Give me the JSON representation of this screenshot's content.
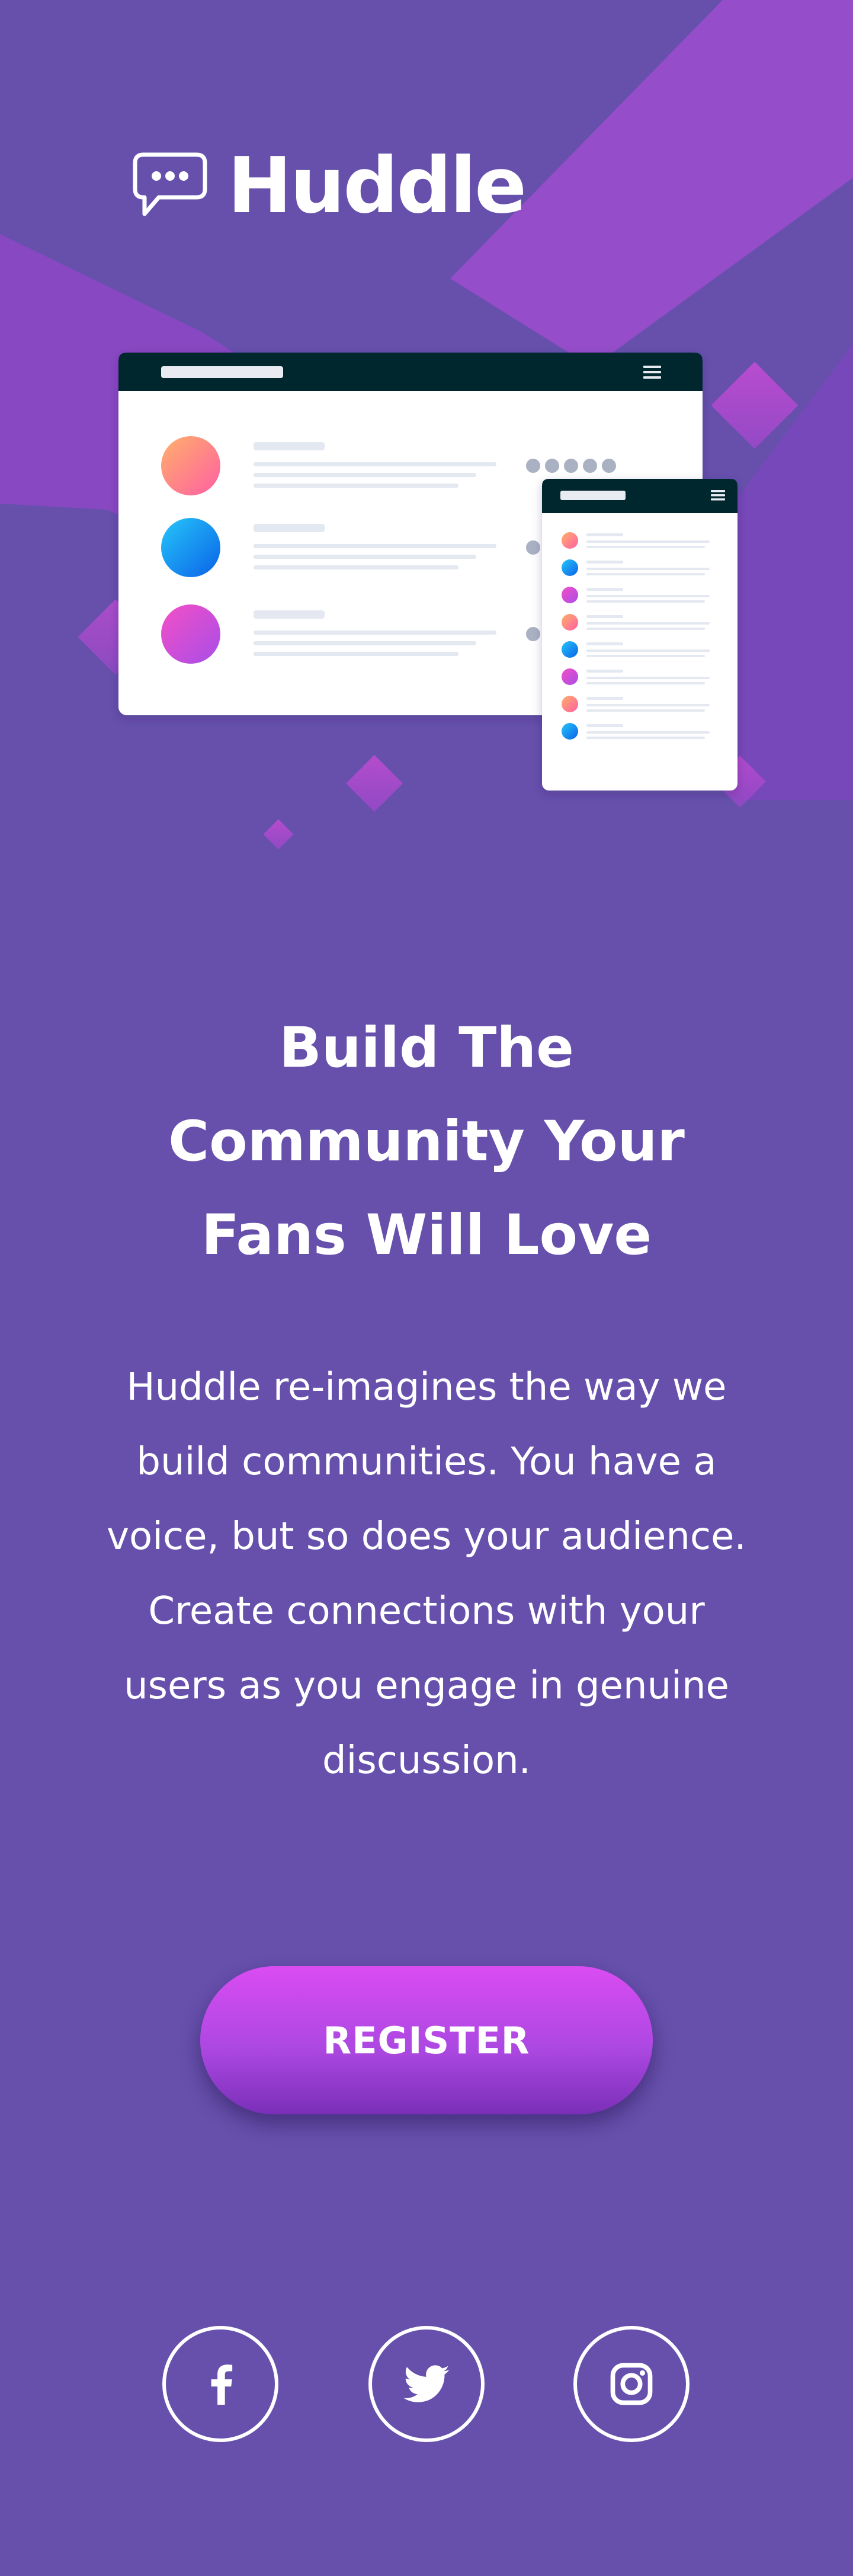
{
  "brand": {
    "name": "Huddle"
  },
  "hero": {
    "headline": "Build The Community Your Fans Will Love",
    "description": "Huddle re-imagines the way we build communities. You have a voice, but so does your audience. Create connections with your users as you engage in genuine discussion.",
    "register_label": "REGISTER"
  },
  "social": {
    "items": [
      {
        "icon": "facebook-icon"
      },
      {
        "icon": "twitter-icon"
      },
      {
        "icon": "instagram-icon"
      }
    ]
  },
  "colors": {
    "background": "#6650ac",
    "accent_purple": "#9549c7",
    "button_gradient_start": "#da4cf2",
    "button_gradient_end": "#7a2fb8",
    "text": "#ffffff"
  }
}
